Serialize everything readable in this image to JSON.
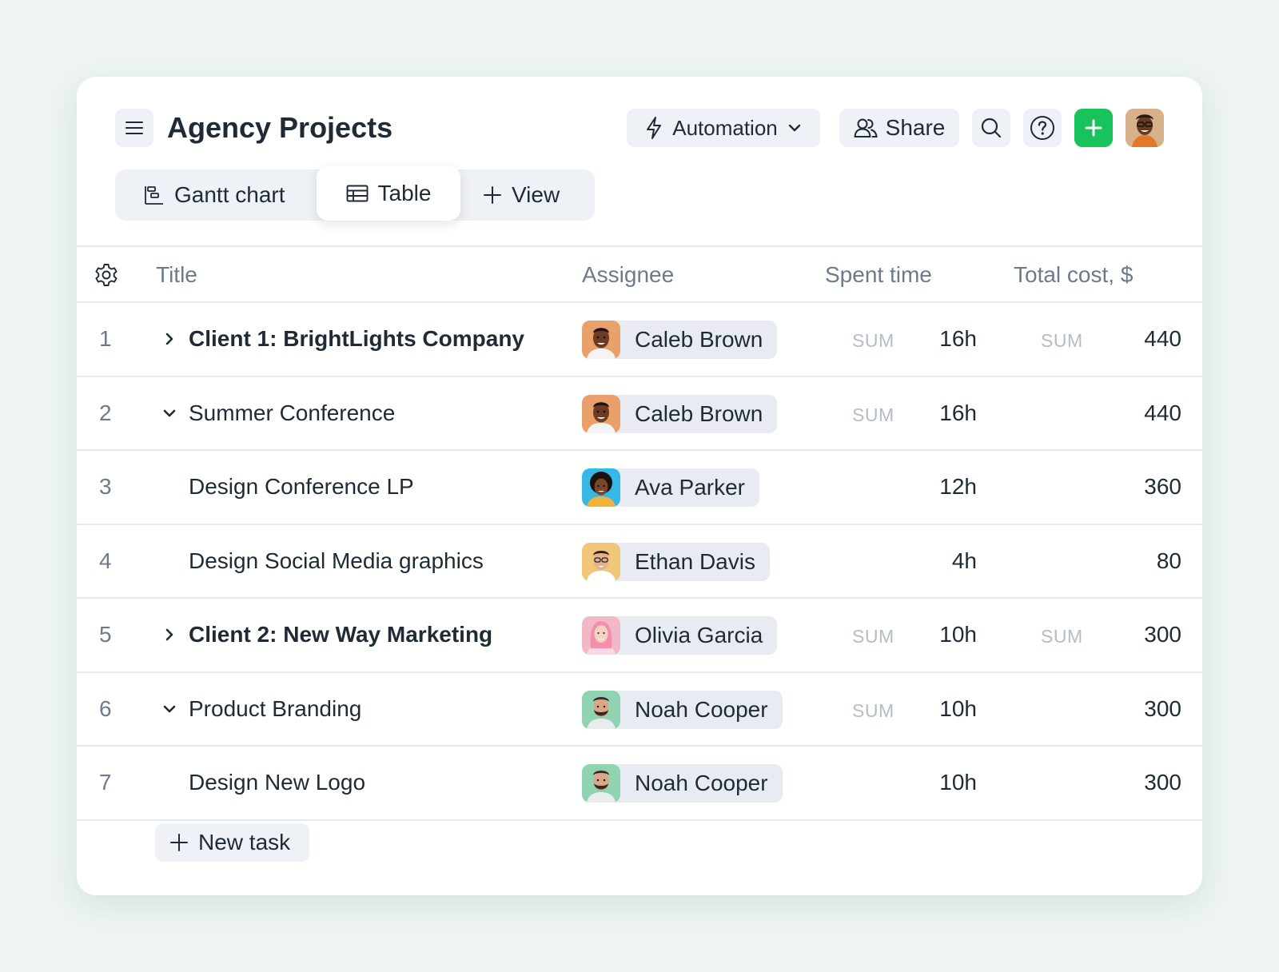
{
  "header": {
    "title": "Agency Projects",
    "automation_label": "Automation",
    "share_label": "Share"
  },
  "tabs": [
    {
      "label": "Gantt chart",
      "icon": "gantt-icon"
    },
    {
      "label": "Table",
      "icon": "table-icon",
      "active": true
    },
    {
      "label": "View",
      "icon": "plus-icon"
    }
  ],
  "table": {
    "columns": [
      "Title",
      "Assignee",
      "Spent time",
      "Total cost, $"
    ],
    "rows": [
      {
        "num": "1",
        "title": "Client 1: BrightLights Company",
        "expand": "collapsed",
        "bold": true,
        "assignee": "Caleb Brown",
        "spent_sum": "SUM",
        "spent": "16h",
        "cost_sum": "SUM",
        "cost": "440"
      },
      {
        "num": "2",
        "title": "Summer Conference",
        "expand": "expanded",
        "bold": false,
        "assignee": "Caleb Brown",
        "spent_sum": "SUM",
        "spent": "16h",
        "cost_sum": "",
        "cost": "440"
      },
      {
        "num": "3",
        "title": "Design Conference LP",
        "expand": "none",
        "bold": false,
        "assignee": "Ava Parker",
        "spent_sum": "",
        "spent": "12h",
        "cost_sum": "",
        "cost": "360"
      },
      {
        "num": "4",
        "title": "Design Social Media graphics",
        "expand": "none",
        "bold": false,
        "assignee": "Ethan Davis",
        "spent_sum": "",
        "spent": "4h",
        "cost_sum": "",
        "cost": "80"
      },
      {
        "num": "5",
        "title": "Client 2: New Way Marketing",
        "expand": "collapsed",
        "bold": true,
        "assignee": "Olivia Garcia",
        "spent_sum": "SUM",
        "spent": "10h",
        "cost_sum": "SUM",
        "cost": "300"
      },
      {
        "num": "6",
        "title": "Product Branding",
        "expand": "expanded",
        "bold": false,
        "assignee": "Noah Cooper",
        "spent_sum": "SUM",
        "spent": "10h",
        "cost_sum": "",
        "cost": "300"
      },
      {
        "num": "7",
        "title": "Design New Logo",
        "expand": "none",
        "bold": false,
        "assignee": "Noah Cooper",
        "spent_sum": "",
        "spent": "10h",
        "cost_sum": "",
        "cost": "300"
      }
    ]
  },
  "new_task_label": "New task",
  "colors": {
    "accent_green": "#19c35b",
    "chip_bg": "#e8ecf2",
    "muted_text": "#6b7a8c",
    "sum_text": "#b4bcc8",
    "page_bg": "#edf4f2"
  }
}
